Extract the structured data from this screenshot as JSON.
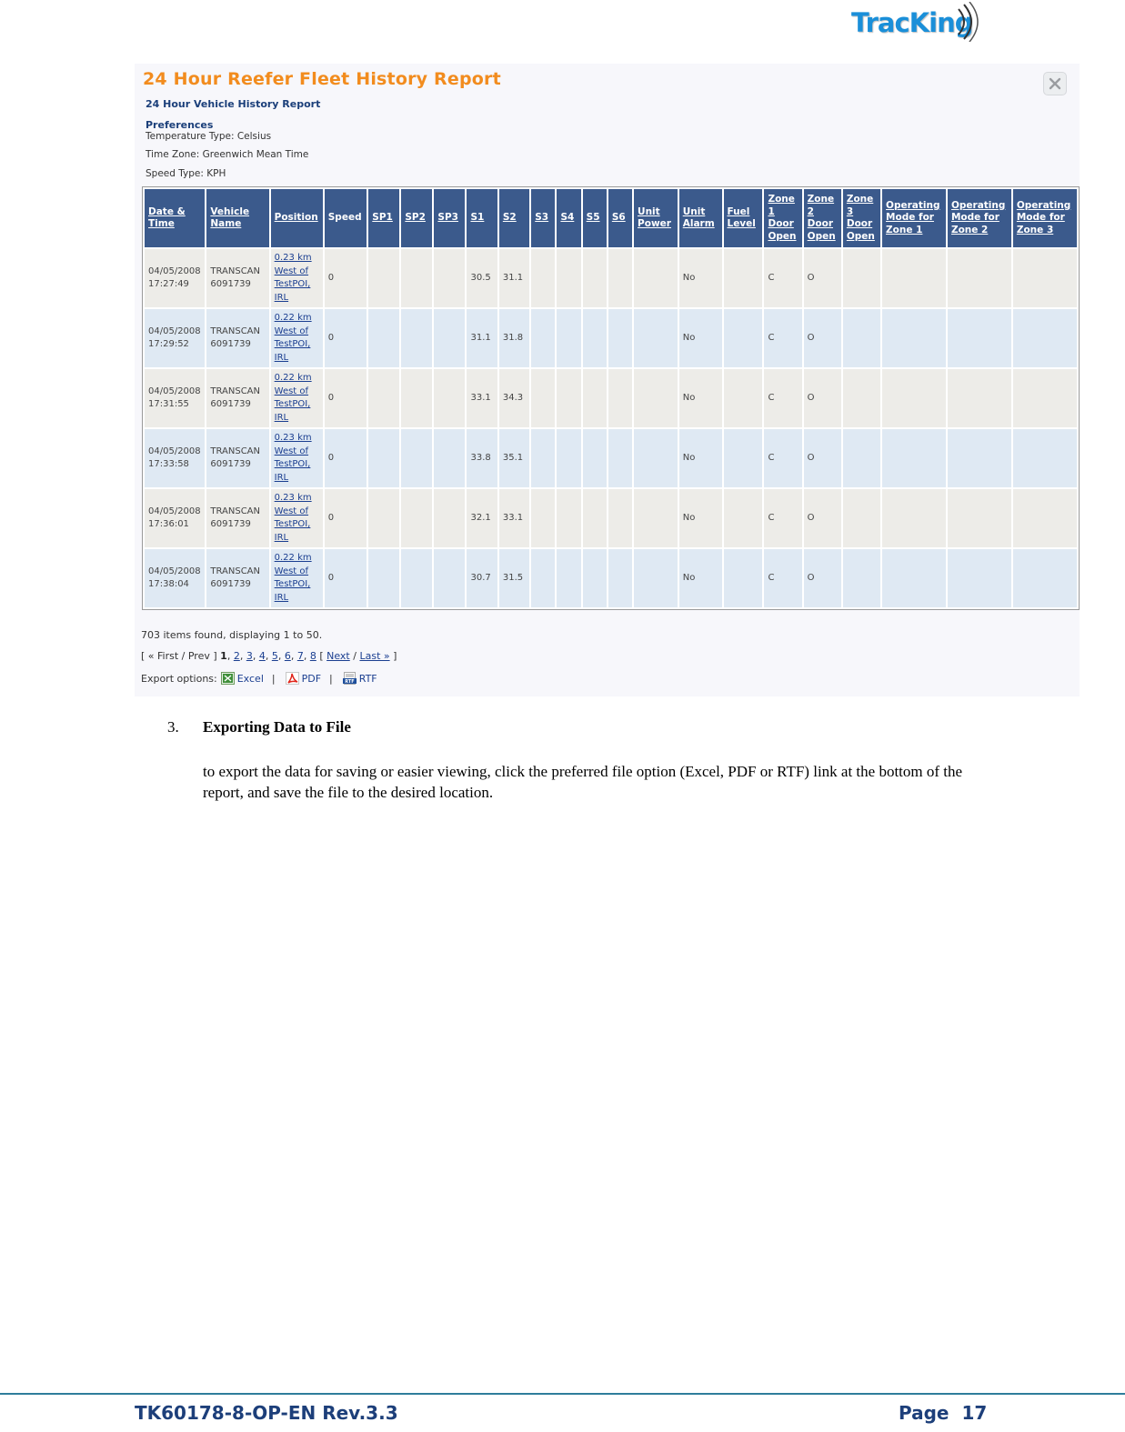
{
  "logo": {
    "text": "TracKing",
    "icon": "signal-arcs-icon"
  },
  "report": {
    "title": "24 Hour Reefer Fleet History Report",
    "subtitle": "24 Hour Vehicle History Report",
    "close_icon": "close-icon",
    "preferences": {
      "heading": "Preferences",
      "lines": [
        "Temperature Type: Celsius",
        "Time Zone: Greenwich Mean Time",
        "Speed Type: KPH"
      ]
    },
    "columns": [
      [
        "Date &",
        "Time"
      ],
      [
        "Vehicle",
        "Name"
      ],
      [
        "Position"
      ],
      [
        "Speed"
      ],
      [
        "SP1"
      ],
      [
        "SP2"
      ],
      [
        "SP3"
      ],
      [
        "S1"
      ],
      [
        "S2"
      ],
      [
        "S3"
      ],
      [
        "S4"
      ],
      [
        "S5"
      ],
      [
        "S6"
      ],
      [
        "Unit",
        "Power"
      ],
      [
        "Unit",
        "Alarm"
      ],
      [
        "Fuel",
        "Level"
      ],
      [
        "Zone",
        "1",
        "Door",
        "Open"
      ],
      [
        "Zone",
        "2",
        "Door",
        "Open"
      ],
      [
        "Zone",
        "3",
        "Door",
        "Open"
      ],
      [
        "Operating",
        "Mode for",
        "Zone 1"
      ],
      [
        "Operating",
        "Mode for",
        "Zone 2"
      ],
      [
        "Operating",
        "Mode for",
        "Zone 3"
      ]
    ],
    "rows": [
      {
        "date": "04/05/2008",
        "time": "17:27:49",
        "vehicle": "TRANSCAN",
        "vehicle_id": "6091739",
        "position": [
          "0.23 km",
          "West of",
          "TestPOI,",
          "IRL"
        ],
        "speed": "0",
        "sp1": "",
        "sp2": "",
        "sp3": "",
        "s1": "30.5",
        "s2": "31.1",
        "s3": "",
        "s4": "",
        "s5": "",
        "s6": "",
        "unit_power": "",
        "unit_alarm": "No",
        "fuel_level": "",
        "zone1_door": "C",
        "zone2_door": "O",
        "zone3_door": "",
        "op_mode_z1": "",
        "op_mode_z2": "",
        "op_mode_z3": ""
      },
      {
        "date": "04/05/2008",
        "time": "17:29:52",
        "vehicle": "TRANSCAN",
        "vehicle_id": "6091739",
        "position": [
          "0.22 km",
          "West of",
          "TestPOI,",
          "IRL"
        ],
        "speed": "0",
        "sp1": "",
        "sp2": "",
        "sp3": "",
        "s1": "31.1",
        "s2": "31.8",
        "s3": "",
        "s4": "",
        "s5": "",
        "s6": "",
        "unit_power": "",
        "unit_alarm": "No",
        "fuel_level": "",
        "zone1_door": "C",
        "zone2_door": "O",
        "zone3_door": "",
        "op_mode_z1": "",
        "op_mode_z2": "",
        "op_mode_z3": ""
      },
      {
        "date": "04/05/2008",
        "time": "17:31:55",
        "vehicle": "TRANSCAN",
        "vehicle_id": "6091739",
        "position": [
          "0.22 km",
          "West of",
          "TestPOI,",
          "IRL"
        ],
        "speed": "0",
        "sp1": "",
        "sp2": "",
        "sp3": "",
        "s1": "33.1",
        "s2": "34.3",
        "s3": "",
        "s4": "",
        "s5": "",
        "s6": "",
        "unit_power": "",
        "unit_alarm": "No",
        "fuel_level": "",
        "zone1_door": "C",
        "zone2_door": "O",
        "zone3_door": "",
        "op_mode_z1": "",
        "op_mode_z2": "",
        "op_mode_z3": ""
      },
      {
        "date": "04/05/2008",
        "time": "17:33:58",
        "vehicle": "TRANSCAN",
        "vehicle_id": "6091739",
        "position": [
          "0.23 km",
          "West of",
          "TestPOI,",
          "IRL"
        ],
        "speed": "0",
        "sp1": "",
        "sp2": "",
        "sp3": "",
        "s1": "33.8",
        "s2": "35.1",
        "s3": "",
        "s4": "",
        "s5": "",
        "s6": "",
        "unit_power": "",
        "unit_alarm": "No",
        "fuel_level": "",
        "zone1_door": "C",
        "zone2_door": "O",
        "zone3_door": "",
        "op_mode_z1": "",
        "op_mode_z2": "",
        "op_mode_z3": ""
      },
      {
        "date": "04/05/2008",
        "time": "17:36:01",
        "vehicle": "TRANSCAN",
        "vehicle_id": "6091739",
        "position": [
          "0.23 km",
          "West of",
          "TestPOI,",
          "IRL"
        ],
        "speed": "0",
        "sp1": "",
        "sp2": "",
        "sp3": "",
        "s1": "32.1",
        "s2": "33.1",
        "s3": "",
        "s4": "",
        "s5": "",
        "s6": "",
        "unit_power": "",
        "unit_alarm": "No",
        "fuel_level": "",
        "zone1_door": "C",
        "zone2_door": "O",
        "zone3_door": "",
        "op_mode_z1": "",
        "op_mode_z2": "",
        "op_mode_z3": ""
      },
      {
        "date": "04/05/2008",
        "time": "17:38:04",
        "vehicle": "TRANSCAN",
        "vehicle_id": "6091739",
        "position": [
          "0.22 km",
          "West of",
          "TestPOI,",
          "IRL"
        ],
        "speed": "0",
        "sp1": "",
        "sp2": "",
        "sp3": "",
        "s1": "30.7",
        "s2": "31.5",
        "s3": "",
        "s4": "",
        "s5": "",
        "s6": "",
        "unit_power": "",
        "unit_alarm": "No",
        "fuel_level": "",
        "zone1_door": "C",
        "zone2_door": "O",
        "zone3_door": "",
        "op_mode_z1": "",
        "op_mode_z2": "",
        "op_mode_z3": ""
      }
    ],
    "summary": "703 items found, displaying 1 to 50.",
    "pager": {
      "open": "[ « First / Prev ]",
      "current": "1",
      "pages": [
        "2",
        "3",
        "4",
        "5",
        "6",
        "7",
        "8"
      ],
      "next_open": "[",
      "next": "Next",
      "slash": "/",
      "last": "Last »",
      "close": "]"
    },
    "export": {
      "label": "Export options:",
      "options": [
        {
          "label": "Excel",
          "icon": "excel-icon"
        },
        {
          "label": "PDF",
          "icon": "pdf-icon"
        },
        {
          "label": "RTF",
          "icon": "rtf-icon"
        }
      ],
      "separator": "|"
    }
  },
  "section": {
    "number": "3.",
    "title": "Exporting Data to File",
    "body": "to export the data for saving or easier viewing, click the preferred file option (Excel, PDF or RTF) link at the bottom of the report, and save the file to the desired location."
  },
  "footer": {
    "doc_id": "TK60178-8-OP-EN Rev.3.3",
    "page_label": "Page",
    "page_number": "17"
  },
  "colors": {
    "header_bg": "#3b5a8c",
    "title_orange": "#f28c1e",
    "row_odd": "#edece8",
    "row_even": "#dfe9f3",
    "link": "#1a3e90",
    "footer_rule": "#2e7d9b",
    "footer_text": "#1d3f7a"
  }
}
